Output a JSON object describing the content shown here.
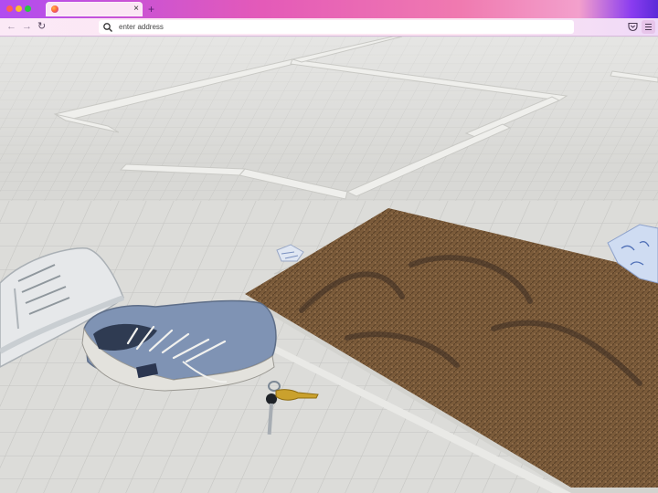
{
  "window": {
    "buttons": [
      "close",
      "minimize",
      "maximize"
    ]
  },
  "tabs": [
    {
      "title": "",
      "favicon": "firefox-icon",
      "active": true
    }
  ],
  "toolbar": {
    "close_tab_glyph": "×",
    "new_tab_glyph": "+",
    "back_glyph": "←",
    "forward_glyph": "→",
    "reload_glyph": "↻"
  },
  "address_bar": {
    "value": "",
    "placeholder": "enter address",
    "icon": "search-icon"
  },
  "toolbar_icons": [
    "pocket-icon",
    "hamburger-menu-icon"
  ],
  "colors": {
    "chrome_gradient_start": "#b14cf0",
    "chrome_gradient_end": "#f3a0cc",
    "tile_floor": "#d9d9d6",
    "doormat": "#7a5a3a"
  },
  "scene": {
    "description_objects": [
      "white-sneaker",
      "blue-sneaker",
      "keys",
      "doormat",
      "crumpled-paper"
    ]
  }
}
